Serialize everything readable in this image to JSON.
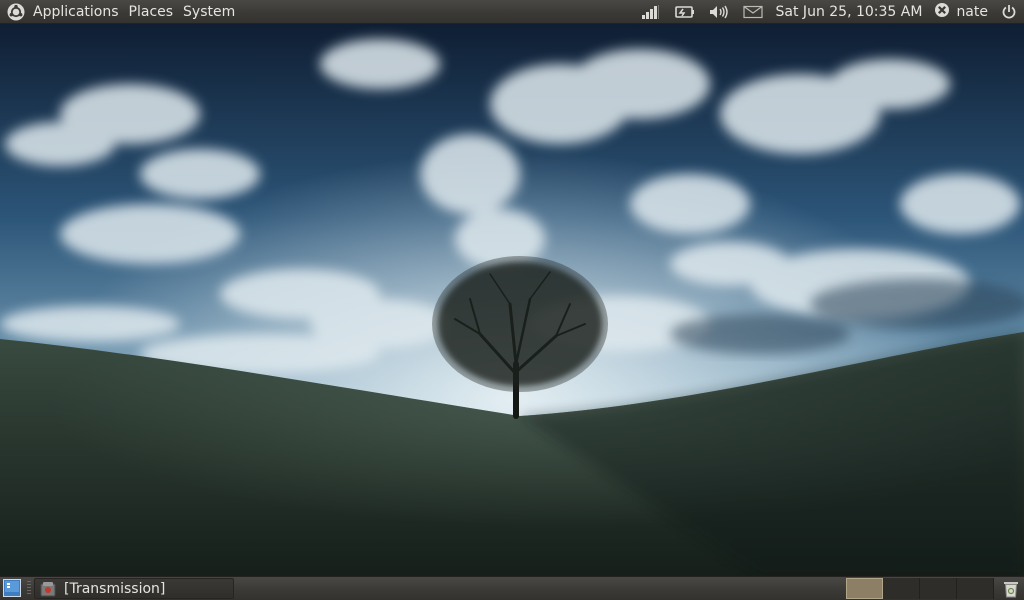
{
  "top_panel": {
    "menus": [
      {
        "label": "Applications"
      },
      {
        "label": "Places"
      },
      {
        "label": "System"
      }
    ],
    "tray_icons": [
      "network-signal-icon",
      "battery-icon",
      "volume-icon",
      "mail-envelope-icon"
    ],
    "clock": "Sat Jun 25, 10:35 AM",
    "user": {
      "name": "nate",
      "icon": "user-status-icon"
    },
    "power_icon": "power-icon"
  },
  "desktop": {
    "wallpaper": "tree-on-grassy-hill-under-cloudy-sky"
  },
  "bottom_panel": {
    "show_desktop_icon": "show-desktop-icon",
    "task": {
      "label": "[Transmission]",
      "icon": "transmission-icon"
    },
    "workspaces": {
      "count": 4,
      "active": 1
    },
    "trash_icon": "trash-icon"
  },
  "colors": {
    "panel": "#3b3a36",
    "panel_text": "#e6e4df",
    "active_workspace": "#8d7f66"
  }
}
